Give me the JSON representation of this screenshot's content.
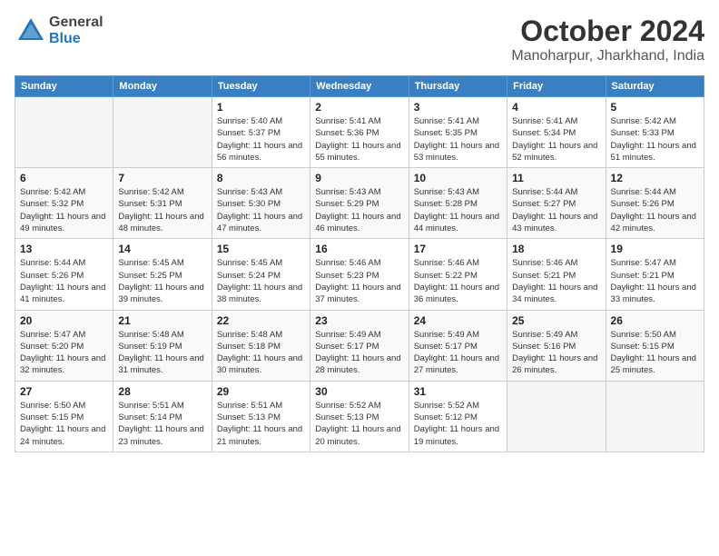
{
  "header": {
    "logo_general": "General",
    "logo_blue": "Blue",
    "title": "October 2024",
    "subtitle": "Manoharpur, Jharkhand, India"
  },
  "weekdays": [
    "Sunday",
    "Monday",
    "Tuesday",
    "Wednesday",
    "Thursday",
    "Friday",
    "Saturday"
  ],
  "weeks": [
    [
      {
        "day": "",
        "detail": ""
      },
      {
        "day": "",
        "detail": ""
      },
      {
        "day": "1",
        "detail": "Sunrise: 5:40 AM\nSunset: 5:37 PM\nDaylight: 11 hours and 56 minutes."
      },
      {
        "day": "2",
        "detail": "Sunrise: 5:41 AM\nSunset: 5:36 PM\nDaylight: 11 hours and 55 minutes."
      },
      {
        "day": "3",
        "detail": "Sunrise: 5:41 AM\nSunset: 5:35 PM\nDaylight: 11 hours and 53 minutes."
      },
      {
        "day": "4",
        "detail": "Sunrise: 5:41 AM\nSunset: 5:34 PM\nDaylight: 11 hours and 52 minutes."
      },
      {
        "day": "5",
        "detail": "Sunrise: 5:42 AM\nSunset: 5:33 PM\nDaylight: 11 hours and 51 minutes."
      }
    ],
    [
      {
        "day": "6",
        "detail": "Sunrise: 5:42 AM\nSunset: 5:32 PM\nDaylight: 11 hours and 49 minutes."
      },
      {
        "day": "7",
        "detail": "Sunrise: 5:42 AM\nSunset: 5:31 PM\nDaylight: 11 hours and 48 minutes."
      },
      {
        "day": "8",
        "detail": "Sunrise: 5:43 AM\nSunset: 5:30 PM\nDaylight: 11 hours and 47 minutes."
      },
      {
        "day": "9",
        "detail": "Sunrise: 5:43 AM\nSunset: 5:29 PM\nDaylight: 11 hours and 46 minutes."
      },
      {
        "day": "10",
        "detail": "Sunrise: 5:43 AM\nSunset: 5:28 PM\nDaylight: 11 hours and 44 minutes."
      },
      {
        "day": "11",
        "detail": "Sunrise: 5:44 AM\nSunset: 5:27 PM\nDaylight: 11 hours and 43 minutes."
      },
      {
        "day": "12",
        "detail": "Sunrise: 5:44 AM\nSunset: 5:26 PM\nDaylight: 11 hours and 42 minutes."
      }
    ],
    [
      {
        "day": "13",
        "detail": "Sunrise: 5:44 AM\nSunset: 5:26 PM\nDaylight: 11 hours and 41 minutes."
      },
      {
        "day": "14",
        "detail": "Sunrise: 5:45 AM\nSunset: 5:25 PM\nDaylight: 11 hours and 39 minutes."
      },
      {
        "day": "15",
        "detail": "Sunrise: 5:45 AM\nSunset: 5:24 PM\nDaylight: 11 hours and 38 minutes."
      },
      {
        "day": "16",
        "detail": "Sunrise: 5:46 AM\nSunset: 5:23 PM\nDaylight: 11 hours and 37 minutes."
      },
      {
        "day": "17",
        "detail": "Sunrise: 5:46 AM\nSunset: 5:22 PM\nDaylight: 11 hours and 36 minutes."
      },
      {
        "day": "18",
        "detail": "Sunrise: 5:46 AM\nSunset: 5:21 PM\nDaylight: 11 hours and 34 minutes."
      },
      {
        "day": "19",
        "detail": "Sunrise: 5:47 AM\nSunset: 5:21 PM\nDaylight: 11 hours and 33 minutes."
      }
    ],
    [
      {
        "day": "20",
        "detail": "Sunrise: 5:47 AM\nSunset: 5:20 PM\nDaylight: 11 hours and 32 minutes."
      },
      {
        "day": "21",
        "detail": "Sunrise: 5:48 AM\nSunset: 5:19 PM\nDaylight: 11 hours and 31 minutes."
      },
      {
        "day": "22",
        "detail": "Sunrise: 5:48 AM\nSunset: 5:18 PM\nDaylight: 11 hours and 30 minutes."
      },
      {
        "day": "23",
        "detail": "Sunrise: 5:49 AM\nSunset: 5:17 PM\nDaylight: 11 hours and 28 minutes."
      },
      {
        "day": "24",
        "detail": "Sunrise: 5:49 AM\nSunset: 5:17 PM\nDaylight: 11 hours and 27 minutes."
      },
      {
        "day": "25",
        "detail": "Sunrise: 5:49 AM\nSunset: 5:16 PM\nDaylight: 11 hours and 26 minutes."
      },
      {
        "day": "26",
        "detail": "Sunrise: 5:50 AM\nSunset: 5:15 PM\nDaylight: 11 hours and 25 minutes."
      }
    ],
    [
      {
        "day": "27",
        "detail": "Sunrise: 5:50 AM\nSunset: 5:15 PM\nDaylight: 11 hours and 24 minutes."
      },
      {
        "day": "28",
        "detail": "Sunrise: 5:51 AM\nSunset: 5:14 PM\nDaylight: 11 hours and 23 minutes."
      },
      {
        "day": "29",
        "detail": "Sunrise: 5:51 AM\nSunset: 5:13 PM\nDaylight: 11 hours and 21 minutes."
      },
      {
        "day": "30",
        "detail": "Sunrise: 5:52 AM\nSunset: 5:13 PM\nDaylight: 11 hours and 20 minutes."
      },
      {
        "day": "31",
        "detail": "Sunrise: 5:52 AM\nSunset: 5:12 PM\nDaylight: 11 hours and 19 minutes."
      },
      {
        "day": "",
        "detail": ""
      },
      {
        "day": "",
        "detail": ""
      }
    ]
  ]
}
